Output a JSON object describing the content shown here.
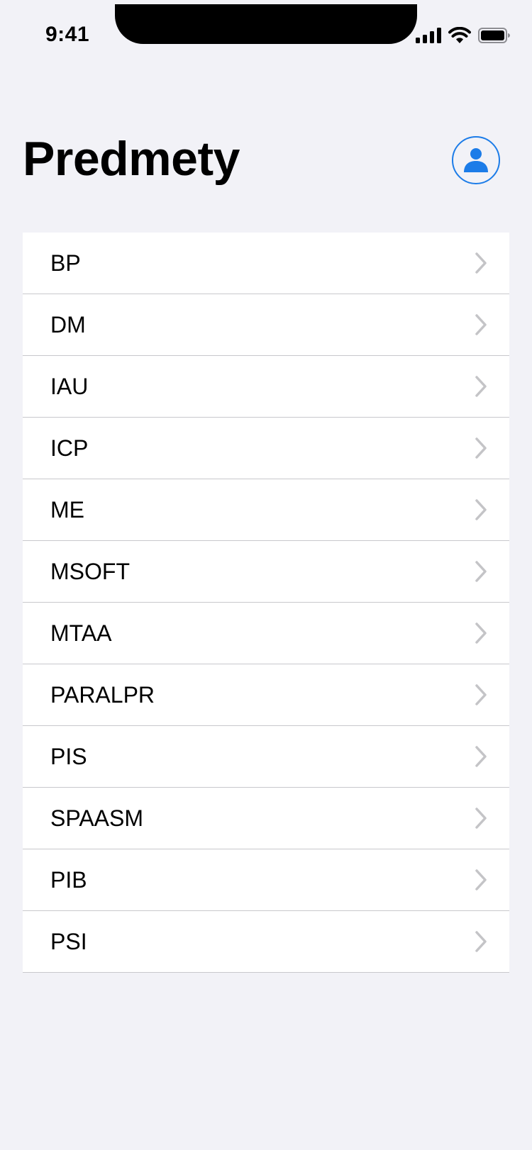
{
  "status_bar": {
    "time": "9:41"
  },
  "header": {
    "title": "Predmety",
    "profile_icon": "person-circle-icon",
    "accent_color": "#1c7ce8"
  },
  "subjects": [
    {
      "label": "BP"
    },
    {
      "label": "DM"
    },
    {
      "label": "IAU"
    },
    {
      "label": "ICP"
    },
    {
      "label": "ME"
    },
    {
      "label": "MSOFT"
    },
    {
      "label": "MTAA"
    },
    {
      "label": "PARALPR"
    },
    {
      "label": "PIS"
    },
    {
      "label": "SPAASM"
    },
    {
      "label": "PIB"
    },
    {
      "label": "PSI"
    }
  ],
  "row_icon": "chevron-right-icon"
}
